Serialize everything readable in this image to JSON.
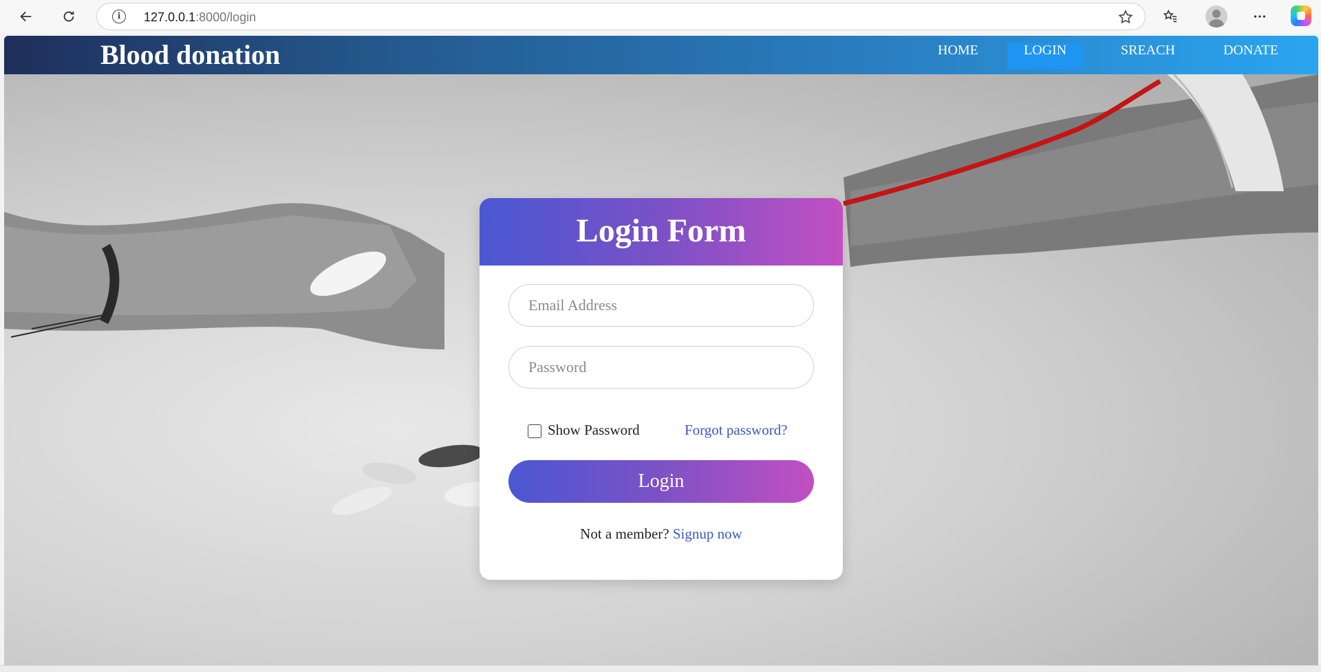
{
  "browser": {
    "url_host": "127.0.0.1",
    "url_path": ":8000/login",
    "icons": [
      "back-arrow-icon",
      "reload-icon",
      "info-icon",
      "star-icon",
      "favorites-icon",
      "profile-icon",
      "more-icon",
      "copilot-icon"
    ]
  },
  "nav": {
    "brand": "Blood donation",
    "items": [
      {
        "label": "HOME",
        "active": false
      },
      {
        "label": "LOGIN",
        "active": true
      },
      {
        "label": "SREACH",
        "active": false
      },
      {
        "label": "DONATE",
        "active": false
      }
    ]
  },
  "login": {
    "title": "Login Form",
    "email_placeholder": "Email Address",
    "password_placeholder": "Password",
    "show_password_label": "Show Password",
    "forgot_link": "Forgot password?",
    "submit_label": "Login",
    "signup_prompt": "Not a member?",
    "signup_link": "Signup now"
  },
  "colors": {
    "nav_gradient_start": "#1f2f5b",
    "nav_gradient_end": "#2aa5f0",
    "nav_active": "#1e95f2",
    "card_gradient_start": "#4a57d3",
    "card_gradient_end": "#c24fc3",
    "link": "#3c57c8",
    "blood": "#c41414"
  }
}
